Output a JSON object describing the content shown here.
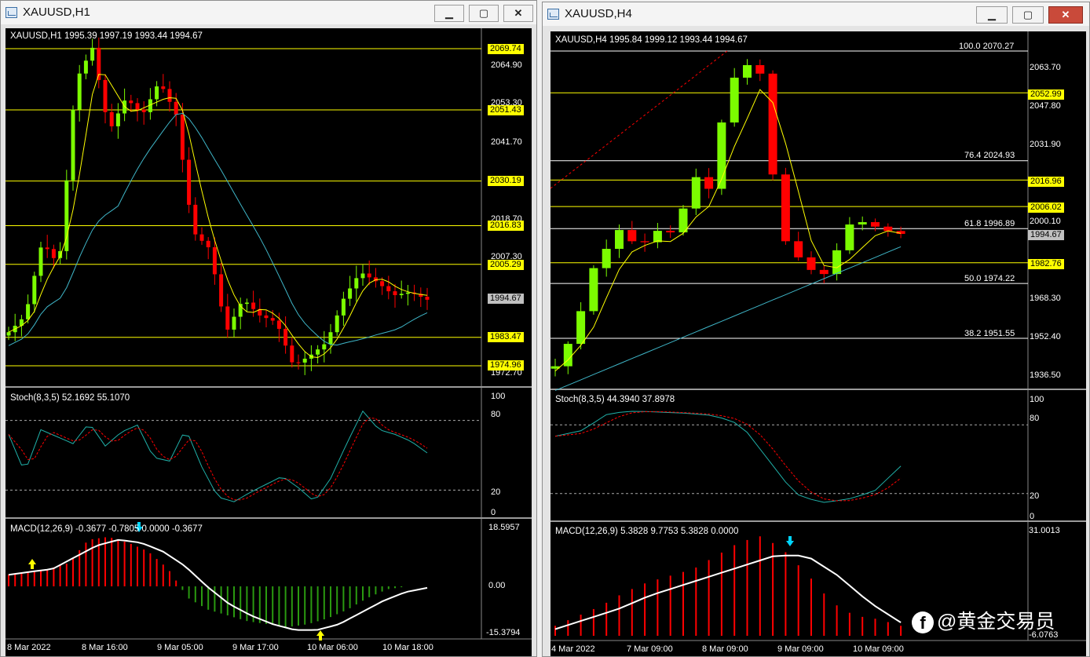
{
  "colors": {
    "up": "#7cfc00",
    "down": "#ff0000",
    "ma_fast": "#ffff00",
    "ma_slow": "#3fb6c8",
    "level": "#ffff00",
    "stoch_main": "#20b2aa",
    "stoch_signal": "#ff0000",
    "macd_hist_pos": "#ff0000",
    "macd_hist_neg": "#2a9a10",
    "macd_line": "#ffffff",
    "arrow_cyan": "#00d5ff",
    "arrow_yellow": "#ffff00"
  },
  "window1": {
    "title": "XAUUSD,H1",
    "main_label": "XAUUSD,H1  1995.39 1997.19 1993.44 1994.67",
    "stoch_label": "Stoch(8,3,5) 52.1692 55.1070",
    "macd_label": "MACD(12,26,9) -0.3677 -0.7805 0.0000 -0.3677",
    "price_axis": [
      "2064.90",
      "2053.30",
      "2041.70",
      "2018.70",
      "2007.30",
      "1972.70"
    ],
    "levels": [
      "2069.74",
      "2051.43",
      "2030.19",
      "2016.83",
      "2005.29",
      "1983.47",
      "1974.96"
    ],
    "current_price": "1994.67",
    "stoch_axis": [
      "100",
      "80",
      "20",
      "0"
    ],
    "macd_axis": [
      "18.5957",
      "0.00",
      "-15.3794"
    ],
    "time_axis": [
      "8 Mar 2022",
      "8 Mar 16:00",
      "9 Mar 05:00",
      "9 Mar 17:00",
      "10 Mar 06:00",
      "10 Mar 18:00"
    ]
  },
  "window2": {
    "title": "XAUUSD,H4",
    "main_label": "XAUUSD,H4  1995.84 1999.12 1993.44 1994.67",
    "stoch_label": "Stoch(8,3,5) 44.3940 37.8978",
    "macd_label": "MACD(12,26,9) 5.3828 9.7753 5.3828 0.0000",
    "price_axis": [
      "2063.70",
      "2047.80",
      "2031.90",
      "2000.10",
      "1968.30",
      "1952.40",
      "1936.50"
    ],
    "levels": [
      "2052.99",
      "2016.96",
      "2006.02",
      "1982.76"
    ],
    "current_price": "1994.67",
    "fib": [
      "100.0  2070.27",
      "76.4  2024.93",
      "61.8  1996.89",
      "50.0  1974.22",
      "38.2  1951.55"
    ],
    "stoch_axis": [
      "100",
      "80",
      "20",
      "0"
    ],
    "macd_axis": [
      "31.0013",
      "-6.0763"
    ],
    "time_axis": [
      "4 Mar 2022",
      "7 Mar 09:00",
      "8 Mar 09:00",
      "9 Mar 09:00",
      "10 Mar 09:00"
    ]
  },
  "watermark": {
    "logo": "f",
    "text": "@黄金交易员"
  }
}
